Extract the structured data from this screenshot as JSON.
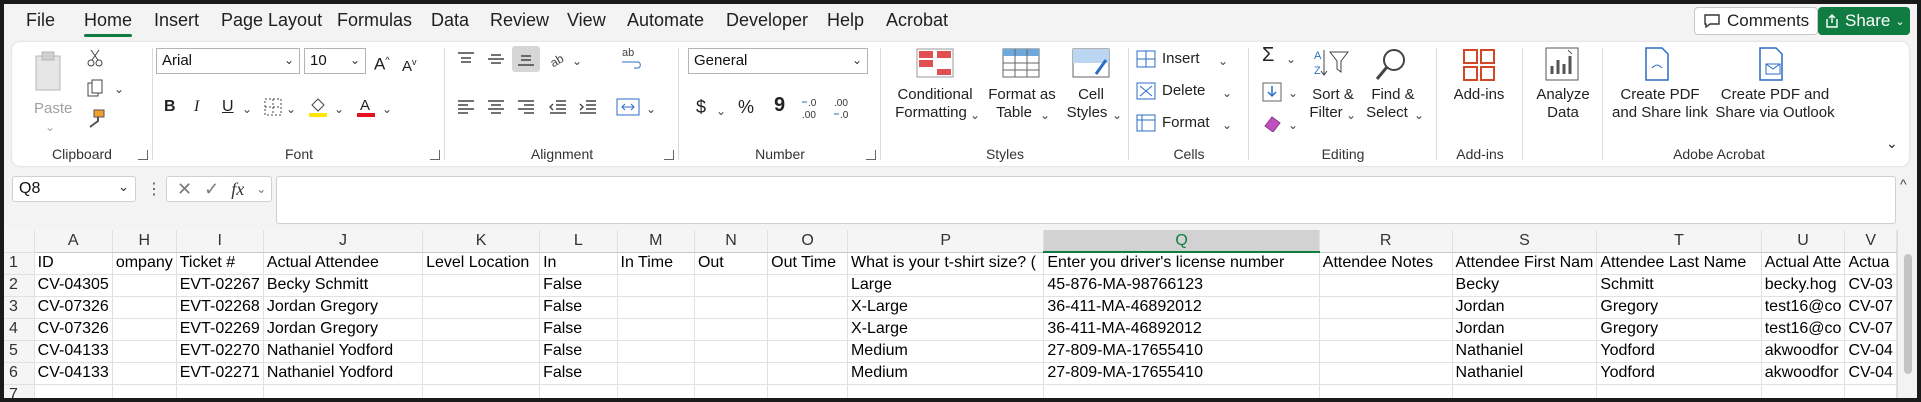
{
  "menu": {
    "tabs": [
      "File",
      "Home",
      "Insert",
      "Page Layout",
      "Formulas",
      "Data",
      "Review",
      "View",
      "Automate",
      "Developer",
      "Help",
      "Acrobat"
    ],
    "active": "Home",
    "comments_label": "Comments",
    "share_label": "Share"
  },
  "ribbon": {
    "clipboard": {
      "paste": "Paste",
      "label": "Clipboard"
    },
    "font": {
      "name": "Arial",
      "size": "10",
      "label": "Font",
      "bold": "B",
      "italic": "I",
      "underline": "U"
    },
    "alignment": {
      "label": "Alignment"
    },
    "number": {
      "format": "General",
      "label": "Number",
      "currency": "$",
      "percent": "%",
      "comma": "9"
    },
    "styles": {
      "conditional_l1": "Conditional",
      "conditional_l2": "Formatting",
      "format_table_l1": "Format as",
      "format_table_l2": "Table",
      "cell_styles_l1": "Cell",
      "cell_styles_l2": "Styles",
      "label": "Styles"
    },
    "cells": {
      "insert": "Insert",
      "delete": "Delete",
      "format": "Format",
      "label": "Cells"
    },
    "editing": {
      "sort_l1": "Sort &",
      "sort_l2": "Filter",
      "find_l1": "Find &",
      "find_l2": "Select",
      "label": "Editing"
    },
    "addins": {
      "button": "Add-ins",
      "label": "Add-ins"
    },
    "analyze": {
      "l1": "Analyze",
      "l2": "Data"
    },
    "acrobat": {
      "create_pdf_l1": "Create PDF",
      "create_pdf_l2": "and Share link",
      "outlook_l1": "Create PDF and",
      "outlook_l2": "Share via Outlook",
      "label": "Adobe Acrobat"
    }
  },
  "formula_bar": {
    "name_box": "Q8",
    "fx": "fx",
    "value": ""
  },
  "grid": {
    "columns": [
      "A",
      "H",
      "I",
      "J",
      "K",
      "L",
      "M",
      "N",
      "O",
      "P",
      "Q",
      "R",
      "S",
      "T",
      "U",
      "V"
    ],
    "selected_column": "Q",
    "rows": [
      {
        "n": "1",
        "cells": [
          "ID",
          "ompany",
          "Ticket #",
          "Actual Attendee",
          "Level Location",
          "In",
          "In Time",
          "Out",
          "Out Time",
          "What is your t-shirt size? (",
          "Enter you driver's license number",
          "Attendee Notes",
          "Attendee First Nam",
          "Attendee Last Name",
          "Actual Atte",
          "Actua"
        ]
      },
      {
        "n": "2",
        "cells": [
          "CV-04305",
          "",
          "EVT-02267",
          "Becky Schmitt",
          "",
          "False",
          "",
          "",
          "",
          "Large",
          "45-876-MA-98766123",
          "",
          "Becky",
          "Schmitt",
          "becky.hog",
          "CV-03"
        ]
      },
      {
        "n": "3",
        "cells": [
          "CV-07326",
          "",
          "EVT-02268",
          "Jordan Gregory",
          "",
          "False",
          "",
          "",
          "",
          "X-Large",
          "36-411-MA-46892012",
          "",
          "Jordan",
          "Gregory",
          "test16@co",
          "CV-07"
        ]
      },
      {
        "n": "4",
        "cells": [
          "CV-07326",
          "",
          "EVT-02269",
          "Jordan Gregory",
          "",
          "False",
          "",
          "",
          "",
          "X-Large",
          "36-411-MA-46892012",
          "",
          "Jordan",
          "Gregory",
          "test16@co",
          "CV-07"
        ]
      },
      {
        "n": "5",
        "cells": [
          "CV-04133",
          "",
          "EVT-02270",
          "Nathaniel Yodford",
          "",
          "False",
          "",
          "",
          "",
          "Medium",
          "27-809-MA-17655410",
          "",
          "Nathaniel",
          "Yodford",
          "akwoodfor",
          "CV-04"
        ]
      },
      {
        "n": "6",
        "cells": [
          "CV-04133",
          "",
          "EVT-02271",
          "Nathaniel Yodford",
          "",
          "False",
          "",
          "",
          "",
          "Medium",
          "27-809-MA-17655410",
          "",
          "Nathaniel",
          "Yodford",
          "akwoodfor",
          "CV-04"
        ]
      },
      {
        "n": "7",
        "cells": [
          "",
          "",
          "",
          "",
          "",
          "",
          "",
          "",
          "",
          "",
          "",
          "",
          "",
          "",
          "",
          ""
        ]
      }
    ]
  },
  "colors": {
    "accent": "#107c41",
    "font_red": "#e81123",
    "highlight_yellow": "#ffe600"
  }
}
